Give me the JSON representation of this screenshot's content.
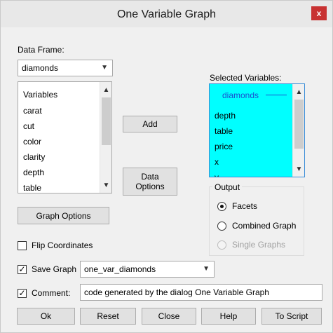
{
  "window": {
    "title": "One Variable Graph",
    "close_glyph": "x"
  },
  "data_frame": {
    "label": "Data Frame:",
    "value": "diamonds"
  },
  "variables_list": {
    "header": "Variables",
    "items": [
      "carat",
      "cut",
      "color",
      "clarity",
      "depth",
      "table"
    ]
  },
  "buttons": {
    "add": "Add",
    "data_options_line1": "Data",
    "data_options_line2": "Options",
    "graph_options": "Graph Options",
    "ok": "Ok",
    "reset": "Reset",
    "close": "Close",
    "help": "Help",
    "to_script": "To Script"
  },
  "selected_variables": {
    "label": "Selected Variables:",
    "header": "diamonds",
    "items": [
      "depth",
      "table",
      "price",
      "x",
      "y"
    ],
    "bg_color": "#00ffff"
  },
  "output": {
    "label": "Output",
    "options": [
      "Facets",
      "Combined Graph",
      "Single Graphs"
    ],
    "selected": "Facets",
    "disabled": "Single Graphs"
  },
  "flip_coordinates": {
    "label": "Flip Coordinates",
    "checked": false
  },
  "save_graph": {
    "label": "Save Graph",
    "checked": true,
    "value": "one_var_diamonds"
  },
  "comment": {
    "label": "Comment:",
    "checked": true,
    "value": "code generated by the dialog One Variable Graph"
  },
  "colors": {
    "close_button": "#c83232",
    "selection": "#00ffff"
  }
}
